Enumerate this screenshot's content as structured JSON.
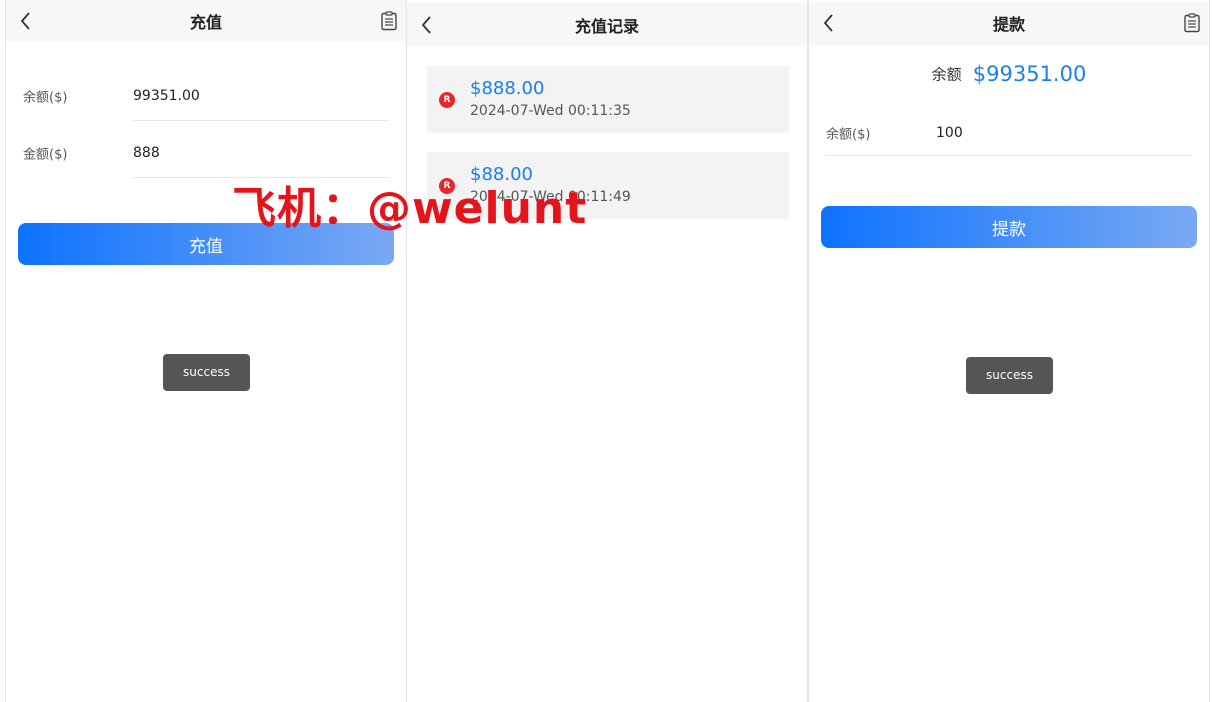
{
  "recharge": {
    "title": "充值",
    "balance_label": "余额($)",
    "balance_value": "99351.00",
    "amount_label": "金额($)",
    "amount_value": "888",
    "submit_label": "充值",
    "toast": "success"
  },
  "records": {
    "title": "充值记录",
    "items": [
      {
        "badge": "R",
        "amount": "$888.00",
        "time": "2024-07-Wed 00:11:35"
      },
      {
        "badge": "R",
        "amount": "$88.00",
        "time": "2024-07-Wed 00:11:49"
      }
    ]
  },
  "withdraw": {
    "title": "提款",
    "balance_label": "余额",
    "balance_value": "$99351.00",
    "amount_label": "余额($)",
    "amount_value": "100",
    "submit_label": "提款",
    "toast": "success"
  },
  "watermark": "飞机：@welunt",
  "icons": {
    "back": "chevron-left-icon",
    "records": "clipboard-icon"
  },
  "colors": {
    "accent": "#1a7ff0",
    "button_start": "#0d72ff",
    "button_end": "#7aa9f3",
    "badge": "#e8262b",
    "watermark": "#e4141d"
  }
}
